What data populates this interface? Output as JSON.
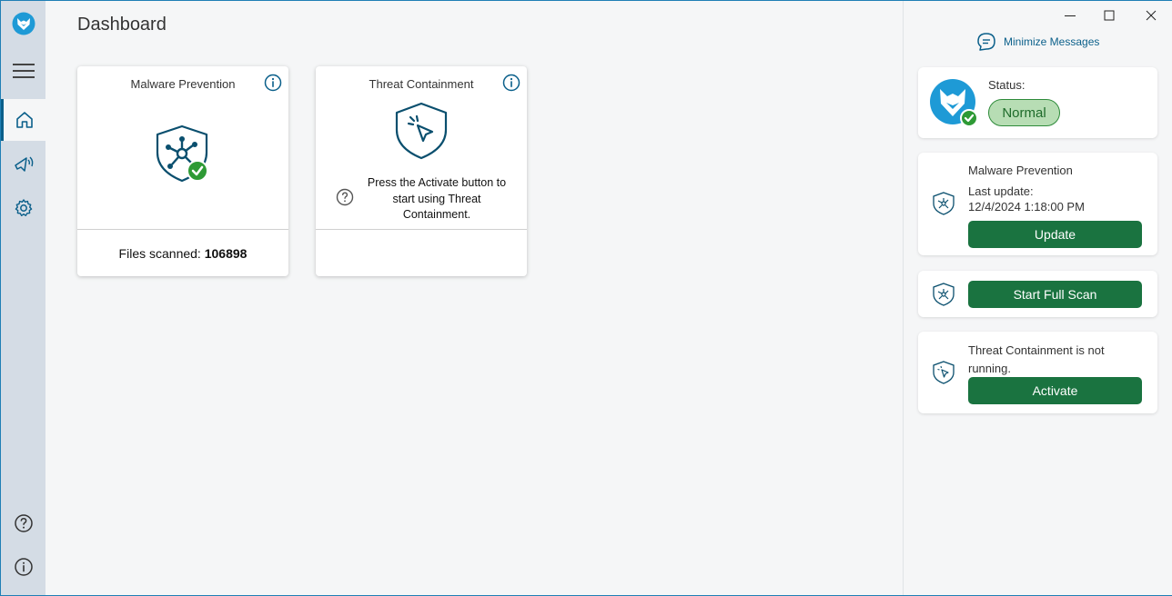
{
  "main": {
    "title": "Dashboard"
  },
  "cards": {
    "malware": {
      "title": "Malware Prevention",
      "files_label": "Files scanned:",
      "files_value": "106898"
    },
    "threat": {
      "title": "Threat Containment",
      "message": "Press the Activate button to start using Threat Containment."
    }
  },
  "panel": {
    "minimize_label": "Minimize Messages",
    "status": {
      "label": "Status:",
      "value": "Normal"
    },
    "malware": {
      "title": "Malware Prevention",
      "last_update_label": "Last update:",
      "last_update_value": "12/4/2024 1:18:00 PM",
      "button": "Update"
    },
    "scan": {
      "button": "Start Full Scan"
    },
    "threat": {
      "message": "Threat Containment is not running.",
      "button": "Activate"
    }
  },
  "colors": {
    "accent": "#0a5f8a",
    "button_green": "#1a7340",
    "status_green_bg": "#b7ddb4",
    "logo_blue": "#1e9ad6",
    "check_green": "#2e9a35"
  },
  "icons": {
    "app_logo": "fox-logo-icon",
    "menu": "hamburger-menu-icon",
    "home": "home-icon",
    "notifications": "megaphone-icon",
    "settings": "gear-icon",
    "help": "help-icon",
    "about": "info-icon"
  }
}
